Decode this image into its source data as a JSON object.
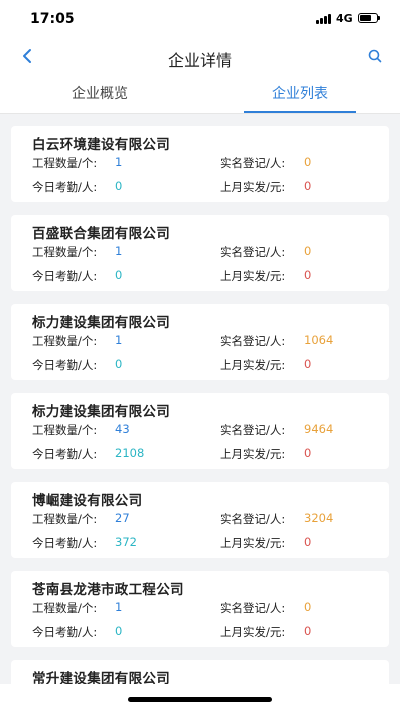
{
  "status": {
    "time": "17:05",
    "network": "4G",
    "battery_level": 0.7
  },
  "nav": {
    "title": "企业详情"
  },
  "tabs": [
    {
      "label": "企业概览",
      "active": false
    },
    {
      "label": "企业列表",
      "active": true
    }
  ],
  "labels": {
    "projects": "工程数量/个:",
    "registered": "实名登记/人:",
    "attendance": "今日考勤/人:",
    "paid": "上月实发/元:"
  },
  "companies": [
    {
      "name": "白云环境建设有限公司",
      "projects": "1",
      "registered": "0",
      "attendance": "0",
      "paid": "0"
    },
    {
      "name": "百盛联合集团有限公司",
      "projects": "1",
      "registered": "0",
      "attendance": "0",
      "paid": "0"
    },
    {
      "name": "标力建设集团有限公司",
      "projects": "1",
      "registered": "1064",
      "attendance": "0",
      "paid": "0"
    },
    {
      "name": "标力建设集团有限公司",
      "projects": "43",
      "registered": "9464",
      "attendance": "2108",
      "paid": "0"
    },
    {
      "name": "博崛建设有限公司",
      "projects": "27",
      "registered": "3204",
      "attendance": "372",
      "paid": "0"
    },
    {
      "name": "苍南县龙港市政工程公司",
      "projects": "1",
      "registered": "0",
      "attendance": "0",
      "paid": "0"
    },
    {
      "name": "常升建设集团有限公司"
    }
  ],
  "colors": {
    "accent": "#2f7fd8",
    "teal": "#2bb5c4",
    "orange": "#e8a13a",
    "red": "#d9534f"
  }
}
